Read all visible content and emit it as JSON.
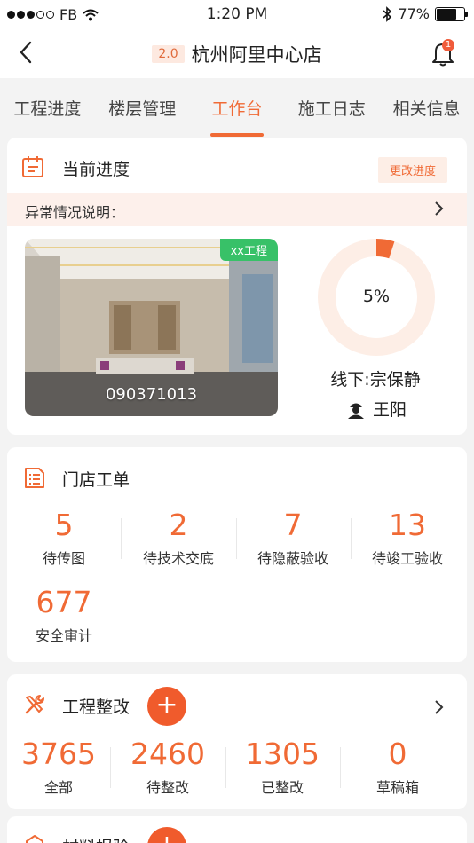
{
  "status_bar": {
    "carrier": "FB",
    "time": "1:20 PM",
    "battery_percent": "77%",
    "battery_level": 0.77
  },
  "nav": {
    "version_badge": "2.0",
    "store_title": "杭州阿里中心店",
    "notification_count": "1"
  },
  "tabs": [
    {
      "label": "工程进度",
      "active": false
    },
    {
      "label": "楼层管理",
      "active": false
    },
    {
      "label": "工作台",
      "active": true
    },
    {
      "label": "施工日志",
      "active": false
    },
    {
      "label": "相关信息",
      "active": false
    }
  ],
  "progress_card": {
    "title": "当前进度",
    "change_button": "更改进度",
    "abnormal_label": "异常情况说明：",
    "project_tag": "xx工程",
    "photo_code": "090371013",
    "percent_text": "5%",
    "percent_value": 0.05,
    "offline_label": "线下:宗保静",
    "worker_name": "王阳"
  },
  "work_orders": {
    "title": "门店工单",
    "stats": [
      {
        "value": "5",
        "label": "待传图"
      },
      {
        "value": "2",
        "label": "待技术交底"
      },
      {
        "value": "7",
        "label": "待隐蔽验收"
      },
      {
        "value": "13",
        "label": "待竣工验收"
      },
      {
        "value": "677",
        "label": "安全审计"
      }
    ]
  },
  "rectification": {
    "title": "工程整改",
    "add_label": "+",
    "stats": [
      {
        "value": "3765",
        "label": "全部"
      },
      {
        "value": "2460",
        "label": "待整改"
      },
      {
        "value": "1305",
        "label": "已整改"
      },
      {
        "value": "0",
        "label": "草稿箱"
      }
    ]
  },
  "materials": {
    "title": "材料报验",
    "add_label": "+"
  },
  "colors": {
    "accent": "#f06a35",
    "tag_green": "#38c168",
    "badge_red": "#f05b3a"
  }
}
